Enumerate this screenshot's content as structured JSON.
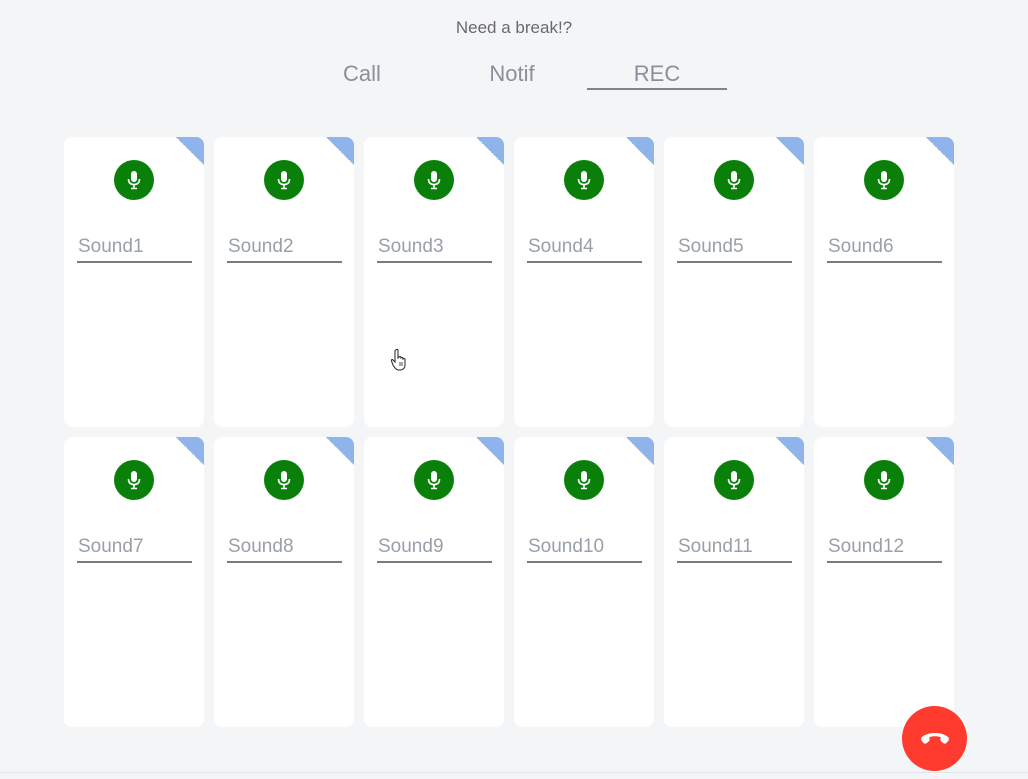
{
  "header": {
    "title": "Need a break!?"
  },
  "tabs": [
    {
      "label": "Call",
      "active": false
    },
    {
      "label": "Notif",
      "active": false
    },
    {
      "label": "REC",
      "active": true
    }
  ],
  "colors": {
    "mic_button": "#0a7f0a",
    "corner_flag": "#8fb4ec",
    "hangup_button": "#ff3b30"
  },
  "icons": {
    "record": "microphone-icon",
    "corner": "corner-flag-icon",
    "hangup": "phone-hangup-icon"
  },
  "sounds": [
    {
      "placeholder": "Sound1"
    },
    {
      "placeholder": "Sound2"
    },
    {
      "placeholder": "Sound3"
    },
    {
      "placeholder": "Sound4"
    },
    {
      "placeholder": "Sound5"
    },
    {
      "placeholder": "Sound6"
    },
    {
      "placeholder": "Sound7"
    },
    {
      "placeholder": "Sound8"
    },
    {
      "placeholder": "Sound9"
    },
    {
      "placeholder": "Sound10"
    },
    {
      "placeholder": "Sound11"
    },
    {
      "placeholder": "Sound12"
    }
  ]
}
